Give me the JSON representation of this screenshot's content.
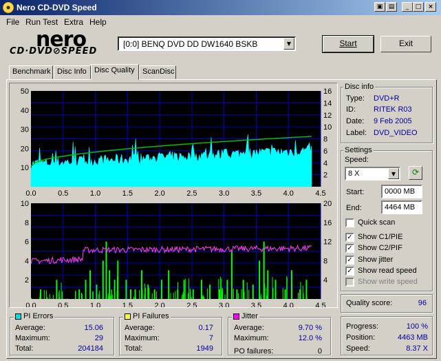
{
  "window": {
    "title": "Nero CD-DVD Speed",
    "controls": [
      "help-button",
      "settings-button",
      "minimize-button",
      "maximize-button",
      "close-button"
    ]
  },
  "menu": [
    "File",
    "Run Test",
    "Extra",
    "Help"
  ],
  "logo": {
    "brand": "nero",
    "product": "CD·DVD⊘SPEED"
  },
  "drive_select": {
    "value": "[0:0]  BENQ DVD DD DW1640 BSKB"
  },
  "buttons": {
    "start": "Start",
    "exit": "Exit"
  },
  "tabs": [
    "Benchmark",
    "Disc Info",
    "Disc Quality",
    "ScanDisc"
  ],
  "active_tab": "Disc Quality",
  "disc_info": {
    "title": "Disc info",
    "type_label": "Type:",
    "type": "DVD+R",
    "id_label": "ID:",
    "id": "RITEK R03",
    "date_label": "Date:",
    "date": "9 Feb 2005",
    "label_label": "Label:",
    "label": "DVD_VIDEO"
  },
  "settings": {
    "title": "Settings",
    "speed_label": "Speed:",
    "speed": "8 X",
    "start_label": "Start:",
    "start": "0000 MB",
    "end_label": "End:",
    "end": "4464 MB",
    "quick_scan": {
      "label": "Quick scan",
      "checked": false
    },
    "show_c1": {
      "label": "Show C1/PIE",
      "checked": true
    },
    "show_c2": {
      "label": "Show C2/PIF",
      "checked": true
    },
    "show_jitter": {
      "label": "Show jitter",
      "checked": true
    },
    "show_read": {
      "label": "Show read speed",
      "checked": true
    },
    "show_write": {
      "label": "Show write speed",
      "checked": false,
      "disabled": true
    }
  },
  "quality": {
    "label": "Quality score:",
    "value": "96"
  },
  "progress": {
    "progress_label": "Progress:",
    "progress": "100 %",
    "position_label": "Position:",
    "position": "4463 MB",
    "speed_label": "Speed:",
    "speed": "8.37 X"
  },
  "pi_errors": {
    "title": "PI Errors",
    "color": "#00e0e0",
    "average_label": "Average:",
    "average": "15.06",
    "maximum_label": "Maximum:",
    "maximum": "29",
    "total_label": "Total:",
    "total": "204184"
  },
  "pi_failures": {
    "title": "PI Failures",
    "color": "#ffff40",
    "average_label": "Average:",
    "average": "0.17",
    "maximum_label": "Maximum:",
    "maximum": "7",
    "total_label": "Total:",
    "total": "1949"
  },
  "jitter": {
    "title": "Jitter",
    "color": "#ff00ff",
    "average_label": "Average:",
    "average": "9.70 %",
    "maximum_label": "Maximum:",
    "maximum": "12.0 %",
    "po_label": "PO failures:",
    "po": "0"
  },
  "chart_data": [
    {
      "type": "area",
      "x_ticks": [
        "0.0",
        "0.5",
        "1.0",
        "1.5",
        "2.0",
        "2.5",
        "3.0",
        "3.5",
        "4.0",
        "4.5"
      ],
      "y_left_ticks": [
        "10",
        "20",
        "30",
        "40",
        "50"
      ],
      "y_right_ticks": [
        "2",
        "4",
        "6",
        "8",
        "10",
        "12",
        "14",
        "16"
      ],
      "xlim": [
        0,
        4.5
      ],
      "ylim_left": [
        0,
        50
      ],
      "ylim_right": [
        0,
        16
      ],
      "x_end": 4.36,
      "series": [
        {
          "values_start": 12,
          "values_end": 19,
          "color": "#00ffff",
          "fill": true
        },
        {
          "read_speed_start": 3.4,
          "read_speed_end": 8.4,
          "color": "#00c000"
        }
      ],
      "colors": {
        "background": "#000000",
        "grid": "#0000c0"
      }
    },
    {
      "type": "bar",
      "x_ticks": [
        "0.0",
        "0.5",
        "1.0",
        "1.5",
        "2.0",
        "2.5",
        "3.0",
        "3.5",
        "4.0",
        "4.5"
      ],
      "y_left_ticks": [
        "2",
        "4",
        "6",
        "8",
        "10"
      ],
      "y_right_ticks": [
        "4",
        "8",
        "12",
        "16",
        "20"
      ],
      "xlim": [
        0,
        4.5
      ],
      "ylim_left": [
        0,
        10
      ],
      "ylim_right": [
        0,
        20
      ],
      "x_end": 4.36,
      "series": [
        {
          "pif_spikes": [
            [
              0.15,
              1
            ],
            [
              0.4,
              2
            ],
            [
              0.75,
              1
            ],
            [
              0.85,
              2
            ],
            [
              0.92,
              3
            ],
            [
              1.02,
              1.5
            ],
            [
              1.12,
              4
            ],
            [
              1.17,
              6
            ],
            [
              1.22,
              3
            ],
            [
              1.3,
              2
            ],
            [
              1.35,
              4
            ],
            [
              1.48,
              2
            ],
            [
              1.55,
              1
            ],
            [
              1.62,
              1
            ],
            [
              1.72,
              3
            ],
            [
              1.82,
              1.5
            ],
            [
              1.92,
              1
            ],
            [
              2.03,
              2
            ],
            [
              2.14,
              3
            ],
            [
              2.28,
              1
            ],
            [
              2.38,
              2
            ],
            [
              2.52,
              1
            ],
            [
              2.65,
              2
            ],
            [
              2.78,
              1.5
            ],
            [
              2.93,
              1
            ],
            [
              3.05,
              2
            ],
            [
              3.12,
              5
            ],
            [
              3.2,
              1
            ],
            [
              3.3,
              2
            ],
            [
              3.45,
              1.5
            ],
            [
              3.55,
              4
            ],
            [
              3.62,
              6
            ],
            [
              3.68,
              3
            ],
            [
              3.8,
              2
            ],
            [
              3.95,
              1
            ],
            [
              4.05,
              3
            ],
            [
              4.18,
              1
            ],
            [
              4.28,
              2
            ]
          ],
          "color": "#00ff00"
        },
        {
          "jitter_start": 7.9,
          "jitter_mid": 10.2,
          "jitter_end": 10.6,
          "color": "#ff40ff"
        }
      ],
      "colors": {
        "background": "#000000",
        "grid": "#0000c0"
      }
    }
  ]
}
